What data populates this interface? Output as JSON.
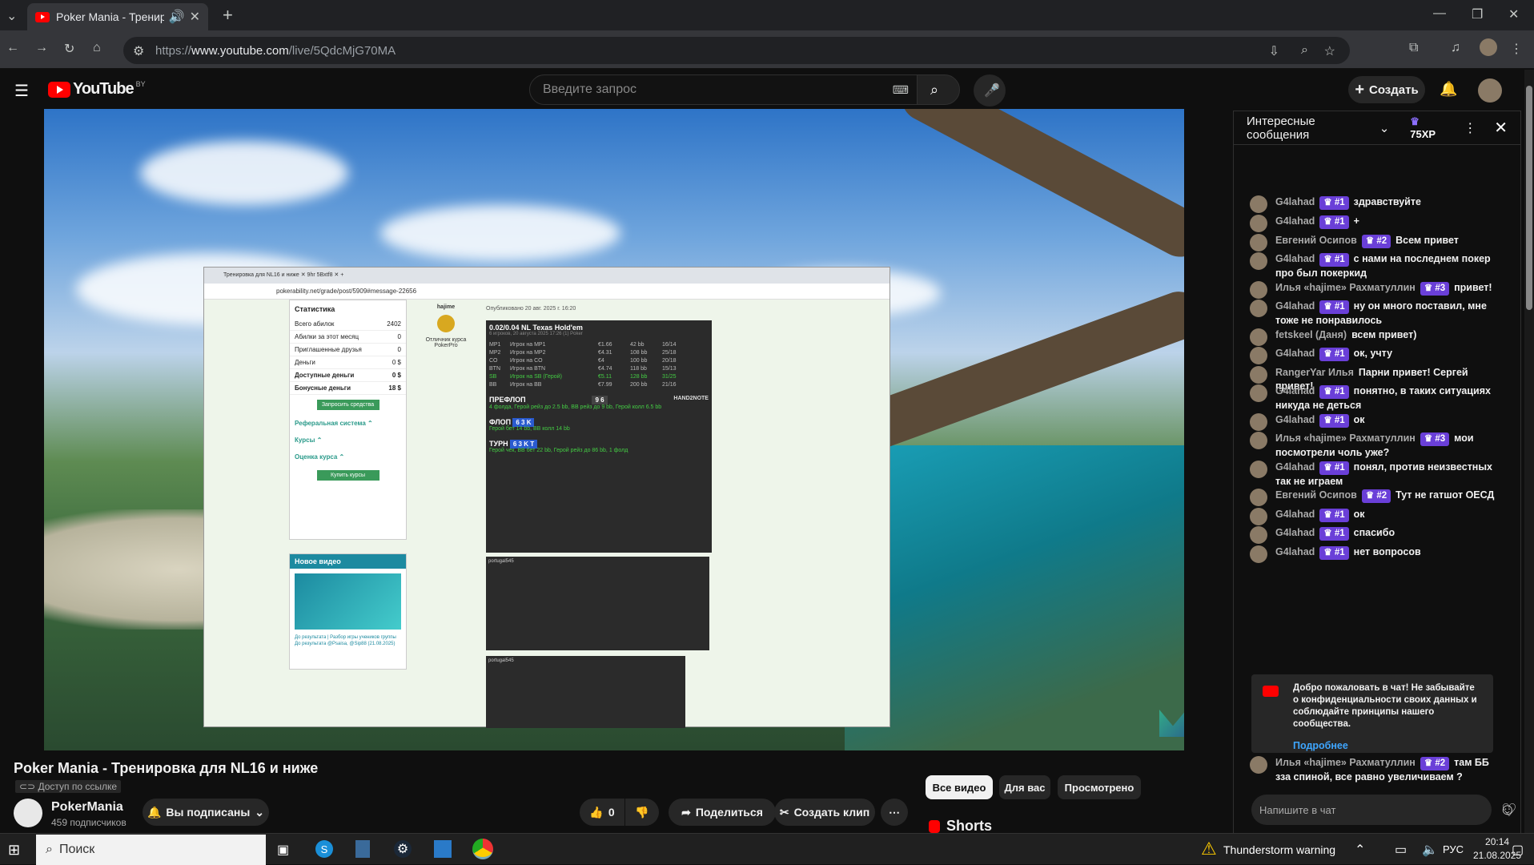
{
  "browser": {
    "tab_title": "Poker Mania - Тренировка",
    "url_prefix": "https://",
    "url_domain": "www.youtube.com",
    "url_path": "/live/5QdcMjG70MA"
  },
  "youtube": {
    "logo_text": "YouTube",
    "region": "BY",
    "search_placeholder": "Введите запрос",
    "create_label": "Создать"
  },
  "video": {
    "inner_tabs": "Тренировка для NL16 и ниже   ✕   9hr 5Bxtf8   ✕   +",
    "inner_url": "pokerability.net/grade/post/5909#message-22656",
    "stats_title": "Статистика",
    "stats_rows": [
      {
        "label": "Всего абилок",
        "value": "2402"
      },
      {
        "label": "Абилки за этот месяц",
        "value": "0"
      },
      {
        "label": "Приглашенные друзья",
        "value": "0"
      },
      {
        "label": "Деньги",
        "value": "0 $"
      },
      {
        "label": "Доступные деньги",
        "value": "0 $"
      },
      {
        "label": "Бонусные деньги",
        "value": "18 $"
      }
    ],
    "withdraw": "Запросить средства",
    "ref_system": "Реферальная система ⌃",
    "courses": "Курсы ⌃",
    "course_rating": "Оценка курса ⌃",
    "buy_courses": "Купить курсы",
    "new_video": "Новое видео",
    "new_video_caption": "До результата | Разбор игры учеников группы До результата @Psaisa, @Sip88 (21.08.2025)",
    "author": "hajime",
    "author_badge": "Отличник курса PokerPro",
    "posted": "Опубликовано 20 авг. 2025 г. 16:20",
    "hand_title": "0.02/0.04 NL Texas Hold'em",
    "hand_sub": "6 игроков, 20 августа 2025 17:26 (1) Poker",
    "players": [
      {
        "pos": "MP1",
        "name": "Игрок на MP1",
        "stack": "€1.66",
        "bb": "42 bb",
        "stat": "16/14"
      },
      {
        "pos": "MP2",
        "name": "Игрок на MP2",
        "stack": "€4.31",
        "bb": "108 bb",
        "stat": "25/18"
      },
      {
        "pos": "CO",
        "name": "Игрок на CO",
        "stack": "€4",
        "bb": "100 bb",
        "stat": "20/18"
      },
      {
        "pos": "BTN",
        "name": "Игрок на BTN",
        "stack": "€4.74",
        "bb": "118 bb",
        "stat": "15/13"
      },
      {
        "pos": "SB",
        "name": "Игрок на SB (Герой)",
        "stack": "€5.11",
        "bb": "128 bb",
        "stat": "31/25"
      },
      {
        "pos": "BB",
        "name": "Игрок на BB",
        "stack": "€7.99",
        "bb": "200 bb",
        "stat": "21/16"
      }
    ],
    "preflop": "ПРЕФЛОП",
    "preflop_cards": "9 6",
    "handnote": "HAND2NOTE",
    "preflop_action": "4 фолда, Герой рейз до 2.5 bb, BB рейз до 9 bb, Герой колл 6.5 bb",
    "flop": "ФЛОП",
    "flop_cards": "6 3 K",
    "flop_action": "Герой бет 14 bb, BB колл 14 bb",
    "turn": "ТУРН",
    "turn_cards": "6 3 K T",
    "turn_action": "Герой чек, BB бет 22 bb, Герой рейз до 86 bb, 1 фолд",
    "stat_player": "portugal545",
    "stat_player2": "portugal545"
  },
  "below": {
    "title": "Poker Mania - Тренировка для NL16 и ниже",
    "access": "Доступ по ссылке",
    "channel": "PokerMania",
    "subscribers": "459 подписчиков",
    "subscribed": "Вы подписаны",
    "likes": "0",
    "share": "Поделиться",
    "clip": "Создать клип",
    "chips": [
      "Все видео",
      "Для вас",
      "Просмотрено"
    ],
    "shorts": "Shorts"
  },
  "chat": {
    "header": "Интересные сообщения",
    "xp": "75XP",
    "messages": [
      {
        "name": "G4lahad",
        "badge": "#1",
        "text": "здравствуйте"
      },
      {
        "name": "G4lahad",
        "badge": "#1",
        "text": "+"
      },
      {
        "name": "Евгений Осипов",
        "badge": "#2",
        "text": "Всем привет"
      },
      {
        "name": "G4lahad",
        "badge": "#1",
        "text": "с нами на последнем покер про был покеркид"
      },
      {
        "name": "Илья «hajime» Рахматуллин",
        "badge": "#3",
        "text": "привет!"
      },
      {
        "name": "G4lahad",
        "badge": "#1",
        "text": "ну он много поставил, мне тоже не понравилось"
      },
      {
        "name": "fetskeel (Даня)",
        "badge": "",
        "text": "всем привет)"
      },
      {
        "name": "G4lahad",
        "badge": "#1",
        "text": "ок, учту"
      },
      {
        "name": "RangerYar Илья",
        "badge": "",
        "text": "Парни привет! Сергей привет!"
      },
      {
        "name": "G4lahad",
        "badge": "#1",
        "text": "понятно, в таких ситуациях никуда не деться"
      },
      {
        "name": "G4lahad",
        "badge": "#1",
        "text": "ок"
      },
      {
        "name": "Илья «hajime» Рахматуллин",
        "badge": "#3",
        "text": "мои посмотрели чоль уже?"
      },
      {
        "name": "G4lahad",
        "badge": "#1",
        "text": "понял, против неизвестных так не играем"
      },
      {
        "name": "Евгений Осипов",
        "badge": "#2",
        "text": "Тут не гатшот ОЕСД"
      },
      {
        "name": "G4lahad",
        "badge": "#1",
        "text": "ок"
      },
      {
        "name": "G4lahad",
        "badge": "#1",
        "text": "спасибо"
      },
      {
        "name": "G4lahad",
        "badge": "#1",
        "text": "нет вопросов"
      }
    ],
    "notice": "Добро пожаловать в чат! Не забывайте о конфиденциальности своих данных и соблюдайте принципы нашего сообщества.",
    "notice_more": "Подробнее",
    "last_message": {
      "name": "Илья «hajime» Рахматуллин",
      "badge": "#2",
      "text": "там ББ зза спиной, все равно увеличиваем ?"
    },
    "input_placeholder": "Напишите в чат"
  },
  "taskbar": {
    "search": "Поиск",
    "weather": "Thunderstorm warning",
    "lang": "РУС",
    "time": "20:14",
    "date": "21.08.2025"
  }
}
